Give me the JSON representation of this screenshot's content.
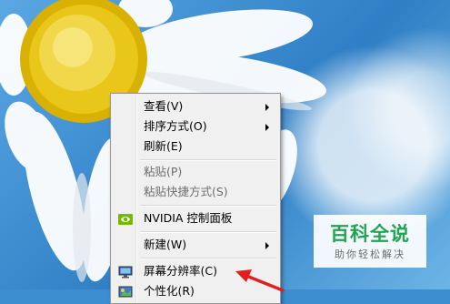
{
  "context_menu": {
    "items": [
      {
        "label": "查看(V)",
        "submenu": true,
        "enabled": true
      },
      {
        "label": "排序方式(O)",
        "submenu": true,
        "enabled": true
      },
      {
        "label": "刷新(E)",
        "submenu": false,
        "enabled": true
      },
      {
        "label": "粘贴(P)",
        "submenu": false,
        "enabled": false
      },
      {
        "label": "粘贴快捷方式(S)",
        "submenu": false,
        "enabled": false
      },
      {
        "label": "NVIDIA 控制面板",
        "submenu": false,
        "enabled": true,
        "icon": "nvidia-icon"
      },
      {
        "label": "新建(W)",
        "submenu": true,
        "enabled": true
      },
      {
        "label": "屏幕分辨率(C)",
        "submenu": false,
        "enabled": true,
        "icon": "display-icon"
      },
      {
        "label": "个性化(R)",
        "submenu": false,
        "enabled": true,
        "icon": "personalize-icon"
      }
    ]
  },
  "watermark": {
    "title": "百科全说",
    "subtitle": "助你轻松解决",
    "color": "#22a454"
  },
  "annotation": {
    "icon": "red-arrow-icon",
    "color": "#e02020"
  }
}
